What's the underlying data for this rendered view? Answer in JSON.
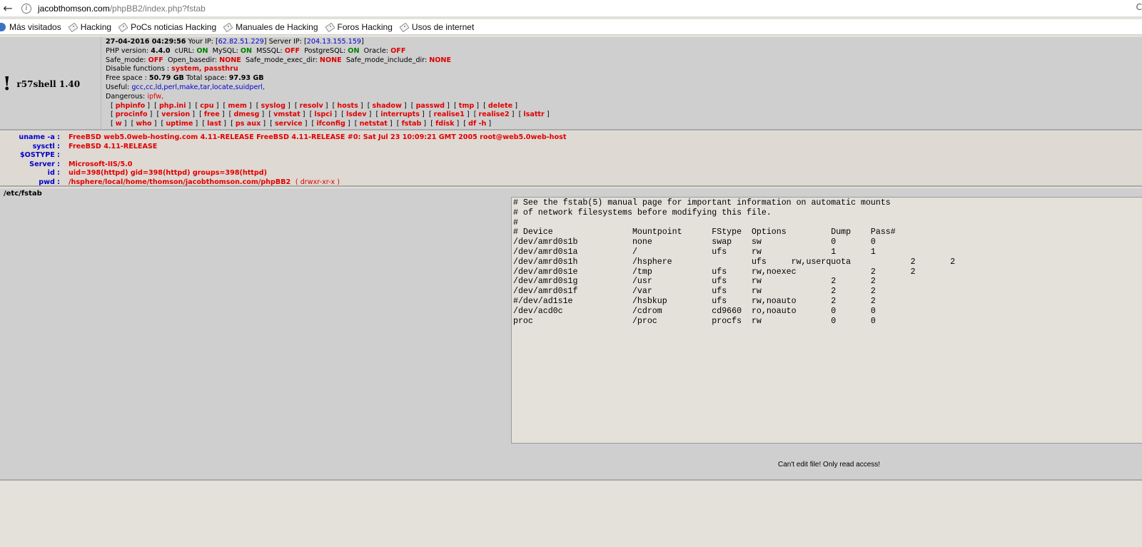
{
  "browser": {
    "url_host": "jacobthomson.com",
    "url_path": "/phpBB2/index.php?fstab",
    "right_edge_char": "C"
  },
  "bookmarks": [
    "Más visitados",
    "Hacking",
    "PoCs noticias Hacking",
    "Manuales de Hacking",
    "Foros Hacking",
    "Usos de internet"
  ],
  "shell": {
    "bang": "!",
    "name": "r57shell 1.40",
    "date": "27-04-2016 04:29:56",
    "your_ip_label": "Your IP:",
    "your_ip": "62.82.51.229",
    "server_ip_label": "Server IP:",
    "server_ip": "204.13.155.159",
    "php_label": "PHP version:",
    "php_version": "4.4.0",
    "curl_label": "cURL:",
    "curl": "ON",
    "mysql_label": "MySQL:",
    "mysql": "ON",
    "mssql_label": "MSSQL:",
    "mssql": "OFF",
    "pgsql_label": "PostgreSQL:",
    "pgsql": "ON",
    "oracle_label": "Oracle:",
    "oracle": "OFF",
    "safe_mode_label": "Safe_mode:",
    "safe_mode": "OFF",
    "open_basedir_label": "Open_basedir:",
    "open_basedir": "NONE",
    "exec_dir_label": "Safe_mode_exec_dir:",
    "exec_dir": "NONE",
    "include_dir_label": "Safe_mode_include_dir:",
    "include_dir": "NONE",
    "disable_label": "Disable functions :",
    "disable": "system, passthru",
    "free_label": "Free space :",
    "free": "50.79 GB",
    "total_label": "Total space:",
    "total": "97.93 GB",
    "useful_label": "Useful:",
    "useful": "gcc,cc,ld,perl,make,tar,locate,suidperl,",
    "dangerous_label": "Dangerous:",
    "dangerous": "ipfw,",
    "commands": [
      [
        "phpinfo",
        "php.ini",
        "cpu",
        "mem",
        "syslog",
        "resolv",
        "hosts",
        "shadow",
        "passwd",
        "tmp",
        "delete"
      ],
      [
        "procinfo",
        "version",
        "free",
        "dmesg",
        "vmstat",
        "lspci",
        "lsdev",
        "interrupts",
        "realise1",
        "realise2",
        "lsattr"
      ],
      [
        "w",
        "who",
        "uptime",
        "last",
        "ps aux",
        "service",
        "ifconfig",
        "netstat",
        "fstab",
        "fdisk",
        "df -h"
      ]
    ]
  },
  "sysinfo": [
    {
      "key": "uname -a :",
      "value": "FreeBSD web5.0web-hosting.com 4.11-RELEASE FreeBSD 4.11-RELEASE #0: Sat Jul 23 10:09:21 GMT 2005 root@web5.0web-host"
    },
    {
      "key": "sysctl :",
      "value": "FreeBSD 4.11-RELEASE"
    },
    {
      "key": "$OSTYPE :",
      "value": ""
    },
    {
      "key": "Server :",
      "value": "Microsoft-IIS/5.0"
    },
    {
      "key": "id :",
      "value": "uid=398(httpd) gid=398(httpd) groups=398(httpd)"
    },
    {
      "key": "pwd :",
      "value": "/hsphere/local/home/thomson/jacobthomson.com/phpBB2",
      "perm": "( drwxr-xr-x )"
    }
  ],
  "file": {
    "path": "/etc/fstab",
    "content": "# See the fstab(5) manual page for important information on automatic mounts\n# of network filesystems before modifying this file.\n#\n# Device                Mountpoint      FStype  Options         Dump    Pass#\n/dev/amrd0s1b           none            swap    sw              0       0\n/dev/amrd0s1a           /               ufs     rw              1       1\n/dev/amrd0s1h           /hsphere                ufs     rw,userquota            2       2\n/dev/amrd0s1e           /tmp            ufs     rw,noexec               2       2\n/dev/amrd0s1g           /usr            ufs     rw              2       2\n/dev/amrd0s1f           /var            ufs     rw              2       2\n#/dev/ad1s1e            /hsbkup         ufs     rw,noauto       2       2\n/dev/acd0c              /cdrom          cd9660  ro,noauto       0       0\nproc                    /proc           procfs  rw              0       0",
    "readonly_msg": "Can't edit file! Only read access!"
  }
}
